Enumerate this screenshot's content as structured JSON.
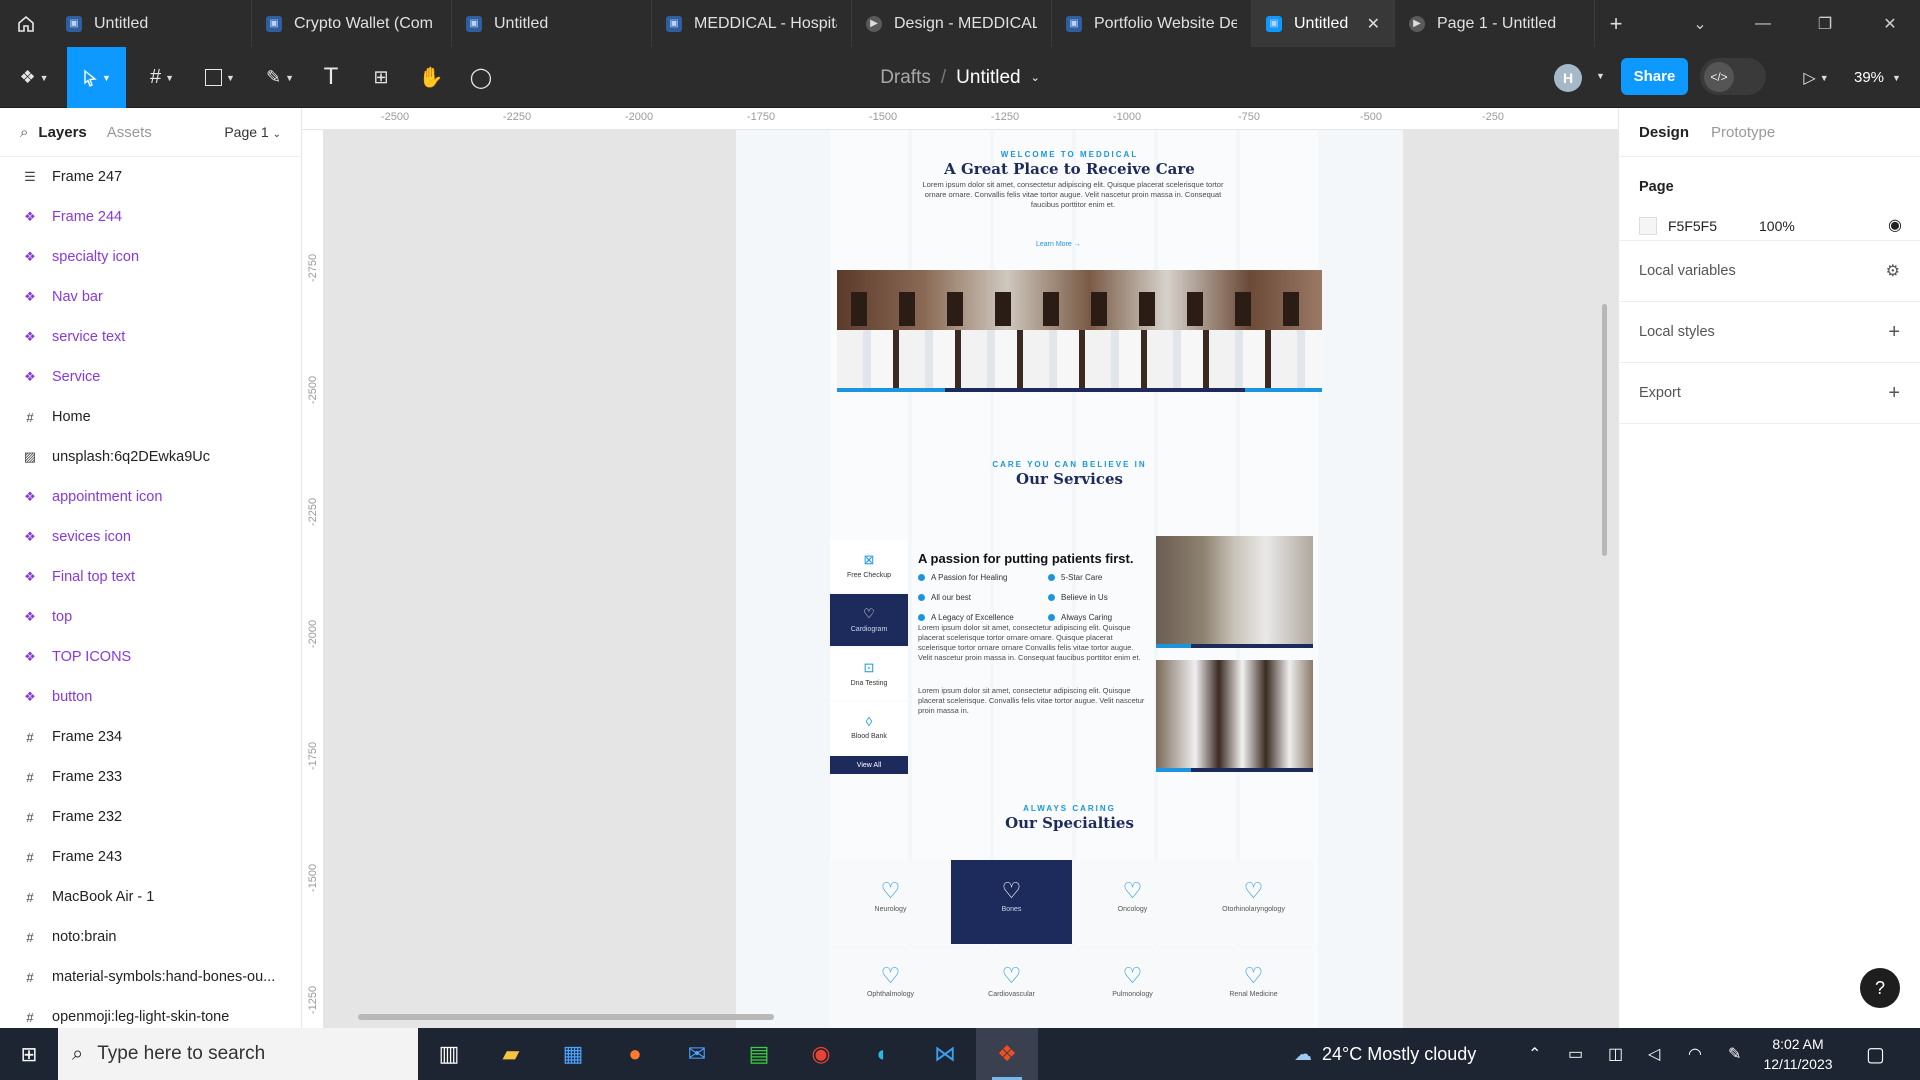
{
  "tabs": [
    {
      "label": "Untitled",
      "icon": "figma-file-icon"
    },
    {
      "label": "Crypto Wallet (Com",
      "icon": "figma-file-icon"
    },
    {
      "label": "Untitled",
      "icon": "figma-file-icon"
    },
    {
      "label": "MEDDICAL - Hospita",
      "icon": "figma-file-icon"
    },
    {
      "label": "Design - MEDDICAL",
      "icon": "prototype-icon"
    },
    {
      "label": "Portfolio Website De",
      "icon": "figma-file-icon"
    },
    {
      "label": "Untitled",
      "icon": "figma-file-icon",
      "active": true
    },
    {
      "label": "Page 1 - Untitled",
      "icon": "prototype-icon"
    }
  ],
  "toolbar": {
    "breadcrumb_root": "Drafts",
    "breadcrumb_sep": "/",
    "file_name": "Untitled",
    "avatar_initial": "H",
    "share_label": "Share",
    "dev_mode_glyph": "</>",
    "zoom": "39%"
  },
  "left_panel": {
    "tab_layers": "Layers",
    "tab_assets": "Assets",
    "page_selector": "Page 1",
    "layers": [
      {
        "name": "Frame 247",
        "type": "autolayout"
      },
      {
        "name": "Frame 244",
        "type": "component"
      },
      {
        "name": "specialty icon",
        "type": "component"
      },
      {
        "name": "Nav bar",
        "type": "component"
      },
      {
        "name": "service text",
        "type": "component"
      },
      {
        "name": "Service",
        "type": "component"
      },
      {
        "name": "Home",
        "type": "frame"
      },
      {
        "name": "unsplash:6q2DEwka9Uc",
        "type": "image"
      },
      {
        "name": "appointment icon",
        "type": "component"
      },
      {
        "name": "sevices icon",
        "type": "component"
      },
      {
        "name": "Final top text",
        "type": "component"
      },
      {
        "name": "top",
        "type": "component"
      },
      {
        "name": "TOP ICONS",
        "type": "component"
      },
      {
        "name": "button",
        "type": "component"
      },
      {
        "name": "Frame 234",
        "type": "frame"
      },
      {
        "name": "Frame 233",
        "type": "frame"
      },
      {
        "name": "Frame 232",
        "type": "frame"
      },
      {
        "name": "Frame 243",
        "type": "frame"
      },
      {
        "name": "MacBook Air - 1",
        "type": "frame"
      },
      {
        "name": "noto:brain",
        "type": "frame"
      },
      {
        "name": "material-symbols:hand-bones-ou...",
        "type": "frame"
      },
      {
        "name": "openmoji:leg-light-skin-tone",
        "type": "frame"
      }
    ]
  },
  "right_panel": {
    "tab_design": "Design",
    "tab_prototype": "Prototype",
    "page_title": "Page",
    "page_color": "F5F5F5",
    "page_opacity": "100%",
    "local_variables": "Local variables",
    "local_styles": "Local styles",
    "export": "Export"
  },
  "rulers": {
    "top": [
      "-2500",
      "-2250",
      "-2000",
      "-1750",
      "-1500",
      "-1250",
      "-1000",
      "-750",
      "-500",
      "-250"
    ],
    "left": [
      "-2750",
      "-2500",
      "-2250",
      "-2000",
      "-1750",
      "-1500",
      "-1250"
    ]
  },
  "design": {
    "hero": {
      "eyebrow": "WELCOME TO MEDDICAL",
      "title": "A Great Place to Receive Care",
      "body": "Lorem ipsum dolor sit amet, consectetur adipiscing elit. Quisque placerat scelerisque tortor ornare ornare. Convallis felis vitae tortor augue. Velit nascetur proin massa in. Consequat faucibus porttitor enim et.",
      "cta": "Learn More →"
    },
    "services": {
      "eyebrow": "CARE YOU CAN BELIEVE IN",
      "title": "Our Services",
      "nav": [
        {
          "label": "Free Checkup",
          "selected": false
        },
        {
          "label": "Cardiogram",
          "selected": true
        },
        {
          "label": "Dna Testing",
          "selected": false
        },
        {
          "label": "Blood Bank",
          "selected": false
        }
      ],
      "view_all": "View All",
      "headline": "A passion for putting patients first.",
      "bullets": [
        "A Passion for Healing",
        "5-Star Care",
        "All our best",
        "Believe in Us",
        "A Legacy of Excellence",
        "Always Caring"
      ],
      "para1": "Lorem ipsum dolor sit amet, consectetur adipiscing elit. Quisque placerat scelerisque tortor ornare ornare. Quisque placerat scelerisque tortor ornare ornare Convallis felis vitae tortor augue. Velit nascetur proin massa in. Consequat faucibus porttitor enim et.",
      "para2": "Lorem ipsum dolor sit amet, consectetur adipiscing elit. Quisque placerat scelerisque. Convallis felis vitae tortor augue. Velit nascetur proin massa in."
    },
    "specialties": {
      "eyebrow": "ALWAYS CARING",
      "title": "Our Specialties",
      "items": [
        {
          "label": "Neurology",
          "selected": false
        },
        {
          "label": "Bones",
          "selected": true
        },
        {
          "label": "Oncology",
          "selected": false
        },
        {
          "label": "Otorhinolaryngology",
          "selected": false
        },
        {
          "label": "Ophthalmology",
          "selected": false
        },
        {
          "label": "Cardiovascular",
          "selected": false
        },
        {
          "label": "Pulmonology",
          "selected": false
        },
        {
          "label": "Renal Medicine",
          "selected": false
        }
      ]
    }
  },
  "taskbar": {
    "search_placeholder": "Type here to search",
    "weather": "24°C  Mostly cloudy",
    "time": "8:02 AM",
    "date": "12/11/2023"
  },
  "colors": {
    "figma_blue": "#0d99ff",
    "navy": "#1d2a5c",
    "accent": "#1b95e0",
    "component_purple": "#8638e5"
  }
}
